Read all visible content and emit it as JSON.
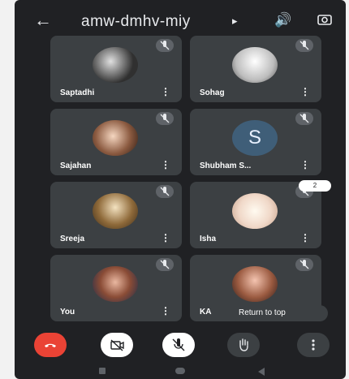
{
  "header": {
    "back_icon": "back-arrow-icon",
    "meeting_code": "amw-dmhv-miy",
    "chevron": "▸",
    "speaker_icon": "speaker-icon",
    "camera_switch_icon": "camera-switch-icon"
  },
  "participants": [
    {
      "name": "Saptadhi",
      "muted": true
    },
    {
      "name": "Sohag",
      "muted": true
    },
    {
      "name": "Sajahan",
      "muted": true
    },
    {
      "name": "Shubham S...",
      "muted": true,
      "initial": "S"
    },
    {
      "name": "Sreeja",
      "muted": true
    },
    {
      "name": "Isha",
      "muted": true
    },
    {
      "name": "You",
      "muted": true
    },
    {
      "name": "KA",
      "muted": true
    }
  ],
  "overlay": {
    "scroll_count": "2",
    "return_to_top": "Return to top"
  },
  "controls": [
    {
      "label": "end-call",
      "icon": "phone-hangup-icon",
      "color": "#ea4335"
    },
    {
      "label": "camera-off",
      "icon": "camera-off-icon"
    },
    {
      "label": "mic-off",
      "icon": "mic-off-icon"
    },
    {
      "label": "raise-hand",
      "icon": "hand-icon"
    },
    {
      "label": "more",
      "icon": "more-vertical-icon"
    }
  ]
}
